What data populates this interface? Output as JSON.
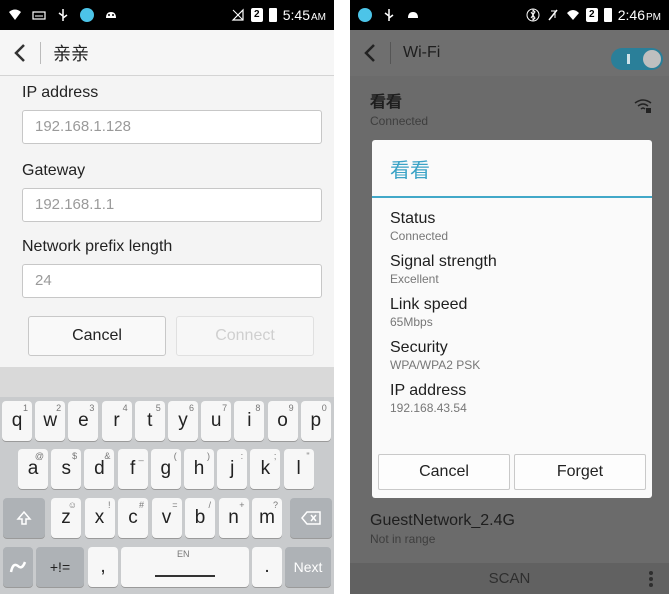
{
  "left": {
    "status": {
      "time": "5:45",
      "ampm": "AM",
      "sim": "2"
    },
    "title": "亲亲",
    "fields": [
      {
        "label": "IP address",
        "value": "192.168.1.128"
      },
      {
        "label": "Gateway",
        "value": "192.168.1.1"
      },
      {
        "label": "Network prefix length",
        "value": "24"
      }
    ],
    "buttons": {
      "cancel": "Cancel",
      "connect": "Connect"
    },
    "keyboard": {
      "row1": [
        [
          "q",
          "1"
        ],
        [
          "w",
          "2"
        ],
        [
          "e",
          "3"
        ],
        [
          "r",
          "4"
        ],
        [
          "t",
          "5"
        ],
        [
          "y",
          "6"
        ],
        [
          "u",
          "7"
        ],
        [
          "i",
          "8"
        ],
        [
          "o",
          "9"
        ],
        [
          "p",
          "0"
        ]
      ],
      "row2": [
        [
          "a",
          "@"
        ],
        [
          "s",
          "$"
        ],
        [
          "d",
          "&"
        ],
        [
          "f",
          "_"
        ],
        [
          "g",
          "("
        ],
        [
          "h",
          ")"
        ],
        [
          "j",
          ":"
        ],
        [
          "k",
          ";"
        ],
        [
          "l",
          "\""
        ]
      ],
      "row3": [
        [
          "z",
          "☺"
        ],
        [
          "x",
          "!"
        ],
        [
          "c",
          "#"
        ],
        [
          "v",
          "="
        ],
        [
          "b",
          "/"
        ],
        [
          "n",
          "+"
        ],
        [
          "m",
          "?"
        ]
      ],
      "symbols_label": "+!=",
      "comma": ",",
      "space_label": "EN",
      "period": ".",
      "next_label": "Next"
    }
  },
  "right": {
    "status": {
      "time": "2:46",
      "ampm": "PM",
      "sim": "2"
    },
    "title": "Wi-Fi",
    "network1": {
      "name": "看看",
      "status": "Connected"
    },
    "network2": {
      "name": "GuestNetwork_2.4G",
      "status": "Not in range"
    },
    "dialog": {
      "title": "看看",
      "items": [
        {
          "label": "Status",
          "value": "Connected"
        },
        {
          "label": "Signal strength",
          "value": "Excellent"
        },
        {
          "label": "Link speed",
          "value": "65Mbps"
        },
        {
          "label": "Security",
          "value": "WPA/WPA2 PSK"
        },
        {
          "label": "IP address",
          "value": "192.168.43.54"
        }
      ],
      "cancel": "Cancel",
      "forget": "Forget"
    },
    "scan_label": "SCAN"
  },
  "colors": {
    "accent": "#3aa3c6",
    "toggle": "#2a7f99",
    "statusbar": "#000000"
  }
}
